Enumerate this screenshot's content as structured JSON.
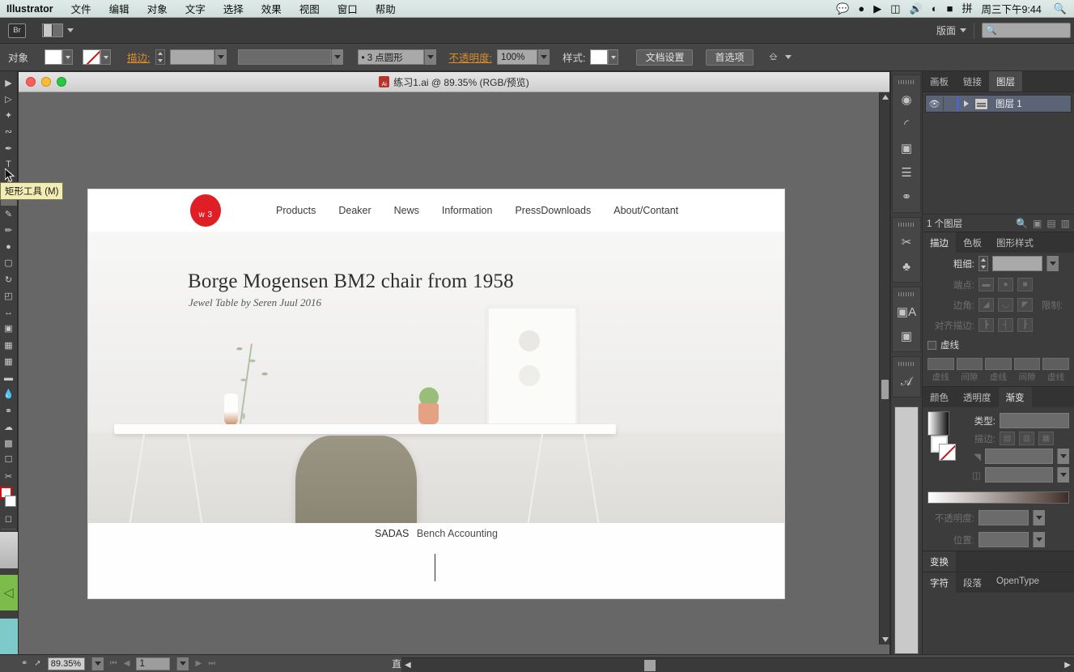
{
  "menubar": {
    "app_name": "Illustrator",
    "items": [
      "文件",
      "编辑",
      "对象",
      "文字",
      "选择",
      "效果",
      "视图",
      "窗口",
      "帮助"
    ],
    "status_icons": [
      "wechat-icon",
      "penguin-icon",
      "screen-record-icon",
      "battery-meter-icon",
      "volume-icon",
      "wifi-icon",
      "battery-icon",
      "input-method-icon"
    ],
    "input_method": "拼",
    "clock": "周三下午9:44",
    "search_icon": "search-icon"
  },
  "control_top": {
    "bridge_label": "Br",
    "arrange_label": "arrange-documents-icon",
    "layout_label": "版面",
    "search_placeholder": ""
  },
  "control_main": {
    "object_label": "对象",
    "fill_swatch": "白色",
    "stroke_swatch": "无",
    "stroke_label": "描边:",
    "stroke_weight": "",
    "stroke_profile": "",
    "brush_label": "• 3 点圆形",
    "opacity_label": "不透明度:",
    "opacity_value": "100%",
    "style_label": "样式:",
    "doc_setup_button": "文档设置",
    "preferences_button": "首选项",
    "select_similar_icon": "select-similar-icon"
  },
  "toolbar": {
    "tooltip": "矩形工具 (M)",
    "tools": [
      "selection-tool",
      "direct-selection-tool",
      "magic-wand-tool",
      "lasso-tool",
      "pen-tool",
      "type-tool",
      "line-tool",
      "rectangle-tool",
      "paintbrush-tool",
      "pencil-tool",
      "blob-brush-tool",
      "eraser-tool",
      "rotate-tool",
      "scale-tool",
      "width-tool",
      "free-transform-tool",
      "shape-builder-tool",
      "perspective-grid-tool",
      "mesh-tool",
      "gradient-tool",
      "eyedropper-tool",
      "blend-tool",
      "symbol-sprayer-tool",
      "column-graph-tool",
      "artboard-tool",
      "slice-tool",
      "hand-tool",
      "zoom-tool"
    ]
  },
  "document": {
    "title": "练习1.ai @ 89.35% (RGB/预览)",
    "app_icon": "ai-file-icon",
    "traffic_lights": [
      "close-button",
      "minimize-button",
      "zoom-button"
    ]
  },
  "artboard": {
    "logo_text": "w 3",
    "nav_links": [
      "Products",
      "Deaker",
      "News",
      "Information",
      "PressDownloads",
      "About/Contant"
    ],
    "hero_title": "Borge Mogensen BM2 chair from 1958",
    "hero_subtitle": "Jewel Table by Seren Juul 2016",
    "caption_bold": "SADAS",
    "caption_rest": "Bench Accounting",
    "accent_color": "#e01e26",
    "chair_color": "#8a8570"
  },
  "rail": {
    "icons": [
      "artboard-panel-icon",
      "gradient-panel-icon",
      "transparency-panel-icon",
      "align-panel-icon",
      "pathfinder-panel-icon",
      "brushes-panel-icon",
      "symbols-panel-icon",
      "appearance-panel-icon",
      "graphic-styles-panel-icon",
      "character-panel-icon"
    ]
  },
  "panels": {
    "top_tabs": [
      {
        "label": "画板",
        "active": false
      },
      {
        "label": "链接",
        "active": false
      },
      {
        "label": "图层",
        "active": true
      }
    ],
    "layer": {
      "name": "图层 1",
      "eye_icon": "eye-icon",
      "expand_icon": "disclosure-triangle-icon",
      "thumbnail_icon": "layer-thumbnail-icon"
    },
    "layers_footer": {
      "count": "1 个图层",
      "icons": [
        "locate-object-icon",
        "make-clipping-mask-icon",
        "create-new-sublayer-icon",
        "create-new-layer-icon",
        "delete-selection-icon"
      ]
    },
    "stroke": {
      "tabs": [
        {
          "label": "描边",
          "active": true
        },
        {
          "label": "色板",
          "active": false
        },
        {
          "label": "图形样式",
          "active": false
        }
      ],
      "weight_label": "粗细:",
      "weight_value": "",
      "cap_label": "端点:",
      "corner_label": "边角:",
      "limit_label": "限制:",
      "align_label": "对齐描边:",
      "dashed_label": "虚线",
      "dash_fields": [
        "虚线",
        "间隙",
        "虚线",
        "间隙",
        "虚线"
      ]
    },
    "gradient": {
      "tabs": [
        {
          "label": "颜色",
          "active": false
        },
        {
          "label": "透明度",
          "active": false
        },
        {
          "label": "渐变",
          "active": true
        }
      ],
      "type_label": "类型:",
      "type_value": "",
      "stroke_label": "描边:",
      "angle_label": "角度:",
      "aspect_label": "长宽比:",
      "opacity_label": "不透明度:",
      "location_label": "位置:"
    },
    "bottom_tabs": [
      {
        "label": "变换",
        "active": true
      },
      {
        "label": "字符",
        "active": true
      },
      {
        "label": "段落",
        "active": false
      },
      {
        "label": "OpenType",
        "active": false
      }
    ]
  },
  "statusbar": {
    "icons": [
      "view-mode-icon",
      "share-icon"
    ],
    "zoom_value": "89.35%",
    "page_value": "1",
    "status_text": "直接选择",
    "nav_first": "first-page-icon",
    "nav_prev": "previous-page-icon",
    "nav_next": "next-page-icon",
    "nav_last": "last-page-icon"
  }
}
